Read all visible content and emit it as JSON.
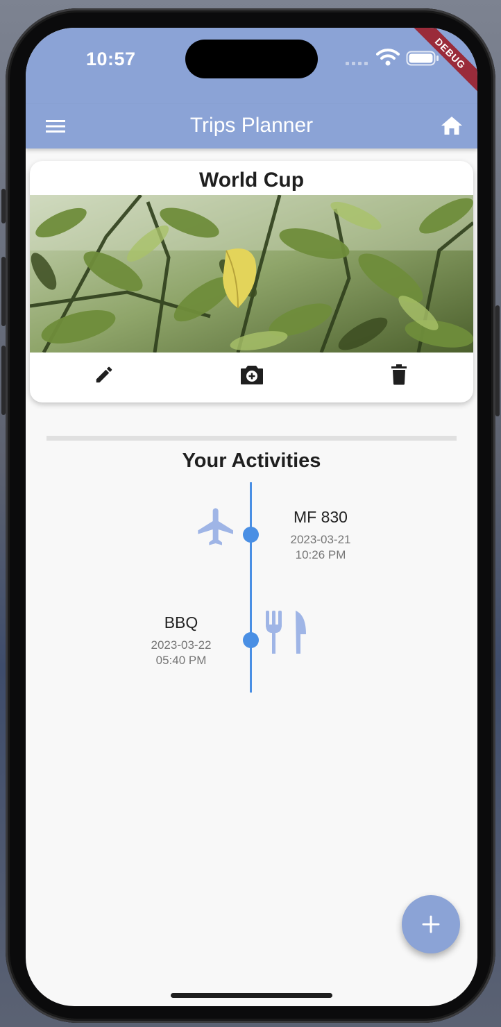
{
  "status_bar": {
    "time": "10:57"
  },
  "debug_banner": "DEBUG",
  "app_bar": {
    "title": "Trips Planner",
    "menu_icon": "hamburger-menu-icon",
    "home_icon": "home-icon"
  },
  "trip_card": {
    "title": "World Cup",
    "photo": "green leaves with yellow butterfly",
    "actions": [
      {
        "name": "edit",
        "icon": "pencil-icon"
      },
      {
        "name": "add-photo",
        "icon": "camera-icon"
      },
      {
        "name": "delete",
        "icon": "trash-icon"
      }
    ]
  },
  "activities": {
    "heading": "Your Activities",
    "items": [
      {
        "title": "MF 830",
        "date": "2023-03-21",
        "time": "10:26 PM",
        "icon": "airplane-icon"
      },
      {
        "title": "BBQ",
        "date": "2023-03-22",
        "time": "05:40 PM",
        "icon": "restaurant-icon"
      }
    ]
  },
  "fab": {
    "icon": "plus-icon"
  },
  "colors": {
    "app_bar": "#8ba3d6",
    "timeline": "#4a8fe4",
    "activity_icon": "#9fb5e6",
    "background": "#f8f8f8"
  }
}
